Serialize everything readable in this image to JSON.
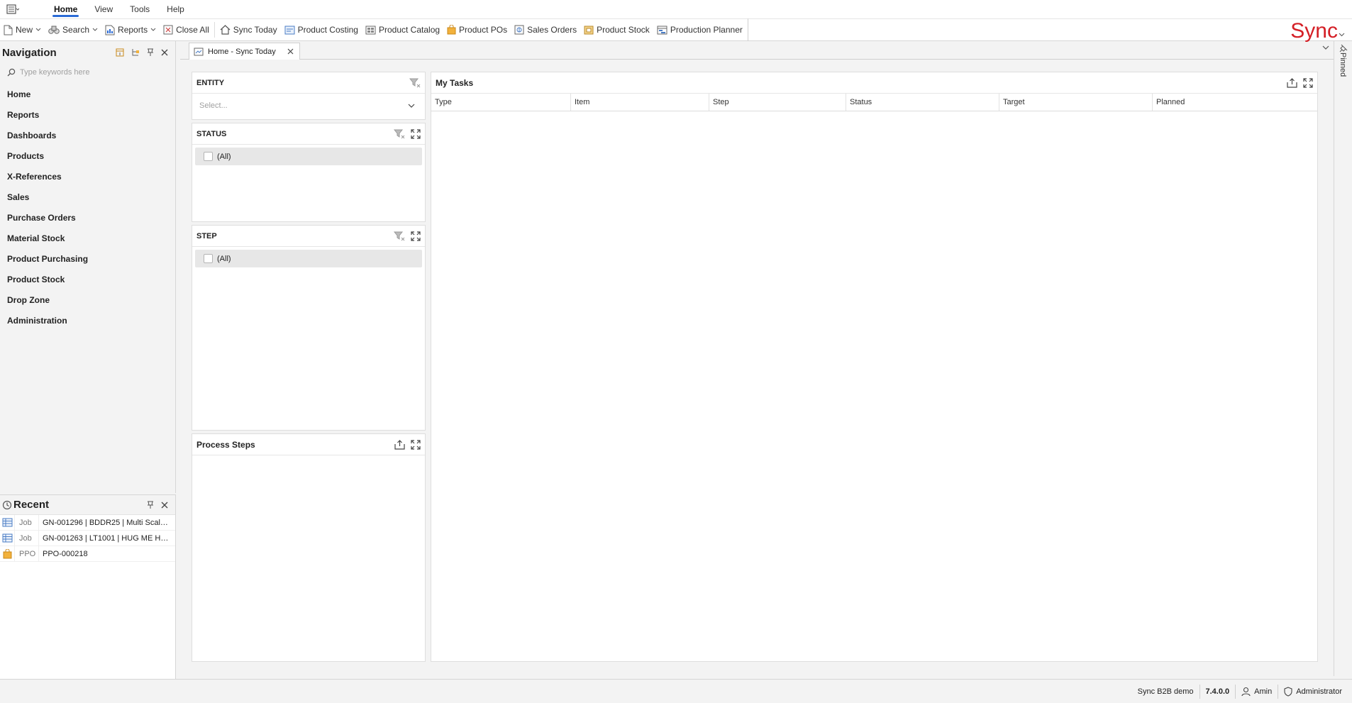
{
  "menubar": {
    "tabs": [
      {
        "label": "Home",
        "active": true
      },
      {
        "label": "View"
      },
      {
        "label": "Tools"
      },
      {
        "label": "Help"
      }
    ]
  },
  "toolbar": {
    "new_label": "New",
    "search_label": "Search",
    "reports_label": "Reports",
    "close_all_label": "Close All",
    "sync_today_label": "Sync Today",
    "product_costing_label": "Product Costing",
    "product_catalog_label": "Product Catalog",
    "product_pos_label": "Product POs",
    "sales_orders_label": "Sales Orders",
    "product_stock_label": "Product Stock",
    "production_planner_label": "Production Planner",
    "brand": "Sync",
    "brand_color": "#d41f26"
  },
  "navigation": {
    "title": "Navigation",
    "search_placeholder": "Type keywords here",
    "items": [
      "Home",
      "Reports",
      "Dashboards",
      "Products",
      "X-References",
      "Sales",
      "Purchase Orders",
      "Material Stock",
      "Product Purchasing",
      "Product Stock",
      "Drop Zone",
      "Administration"
    ]
  },
  "recent": {
    "title": "Recent",
    "items": [
      {
        "type": "Job",
        "description": "GN-001296 | BDDR25 | Multi Scale S...",
        "icon": "grid-icon"
      },
      {
        "type": "Job",
        "description": "GN-001263 | LT1001 | HUG ME HEA...",
        "icon": "grid-icon"
      },
      {
        "type": "PPO",
        "description": "PPO-000218",
        "icon": "bag-icon"
      }
    ]
  },
  "document": {
    "tab_label": "Home - Sync Today",
    "pinned_label": "Pinned"
  },
  "filters": {
    "entity": {
      "title": "ENTITY",
      "placeholder": "Select..."
    },
    "status": {
      "title": "STATUS",
      "all_label": "(All)"
    },
    "step": {
      "title": "STEP",
      "all_label": "(All)"
    }
  },
  "process_steps": {
    "title": "Process Steps"
  },
  "tasks": {
    "title": "My Tasks",
    "columns": [
      "Type",
      "Item",
      "Step",
      "Status",
      "Target",
      "Planned"
    ]
  },
  "statusbar": {
    "environment": "Sync B2B demo",
    "version": "7.4.0.0",
    "user": "Amin",
    "role": "Administrator"
  },
  "colors": {
    "accent": "#2b6bd6",
    "brand": "#d41f26"
  }
}
